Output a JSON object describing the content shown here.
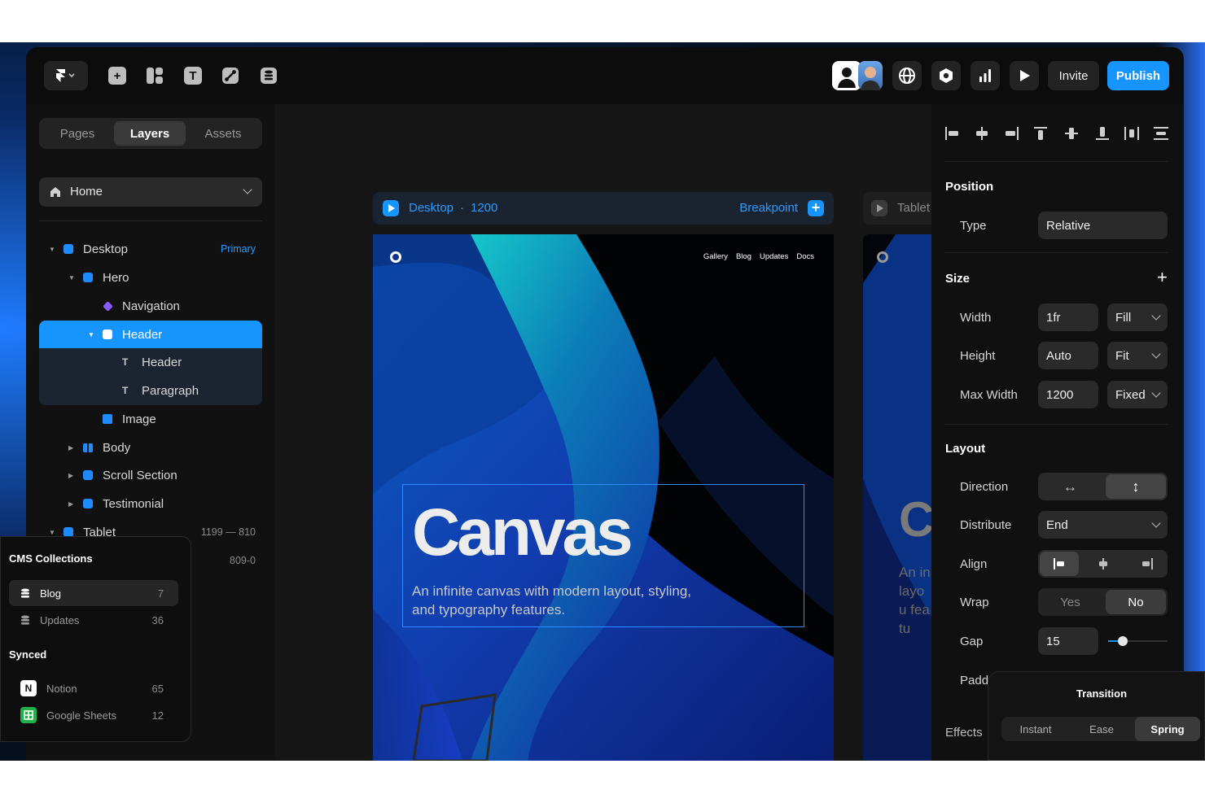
{
  "toolbar": {
    "logo_icon": "framer-logo-icon",
    "tools": [
      "insert-icon",
      "layout-icon",
      "text-icon",
      "vector-icon",
      "cms-icon"
    ],
    "right_icons": [
      "globe-icon",
      "settings-icon",
      "analytics-icon",
      "play-icon"
    ],
    "invite_label": "Invite",
    "publish_label": "Publish",
    "accent": "#1795ff"
  },
  "left_panel": {
    "tabs": [
      "Pages",
      "Layers",
      "Assets"
    ],
    "active_tab": "Layers",
    "page_select": "Home",
    "layers": [
      {
        "label": "Desktop",
        "tag": "Primary"
      },
      {
        "label": "Hero"
      },
      {
        "label": "Navigation"
      },
      {
        "label": "Header"
      },
      {
        "label": "Header"
      },
      {
        "label": "Paragraph"
      },
      {
        "label": "Image"
      },
      {
        "label": "Body"
      },
      {
        "label": "Scroll Section"
      },
      {
        "label": "Testimonial"
      },
      {
        "label": "Tablet",
        "range": "1199 — 810"
      },
      {
        "label": "",
        "range": "809-0"
      }
    ]
  },
  "cms": {
    "title": "CMS Collections",
    "collections": [
      {
        "name": "Blog",
        "count": "7"
      },
      {
        "name": "Updates",
        "count": "36"
      }
    ],
    "synced_title": "Synced",
    "synced": [
      {
        "name": "Notion",
        "count": "65"
      },
      {
        "name": "Google Sheets",
        "count": "12"
      }
    ]
  },
  "canvas": {
    "breakpoint_name": "Desktop",
    "breakpoint_sep": "·",
    "breakpoint_width": "1200",
    "breakpoint_label": "Breakpoint",
    "second_breakpoint": "Tablet",
    "nav_links": [
      "Gallery",
      "Blog",
      "Updates",
      "Docs"
    ],
    "hero_title": "Canvas",
    "hero_subtitle": "An infinite canvas with modern layout, styling, and typography features.",
    "second_frame_title": "C",
    "second_frame_text": "An in layou featu"
  },
  "right_panel": {
    "position_title": "Position",
    "type_label": "Type",
    "type_value": "Relative",
    "size_title": "Size",
    "width_label": "Width",
    "width_value": "1fr",
    "width_mode": "Fill",
    "height_label": "Height",
    "height_value": "Auto",
    "height_mode": "Fit",
    "maxwidth_label": "Max Width",
    "maxwidth_value": "1200",
    "maxwidth_mode": "Fixed",
    "layout_title": "Layout",
    "direction_label": "Direction",
    "distribute_label": "Distribute",
    "distribute_value": "End",
    "align_label": "Align",
    "wrap_label": "Wrap",
    "wrap_yes": "Yes",
    "wrap_no": "No",
    "gap_label": "Gap",
    "gap_value": "15",
    "padding_label": "Padd",
    "effects_label": "Effects"
  },
  "transition": {
    "title": "Transition",
    "options": [
      "Instant",
      "Ease",
      "Spring"
    ],
    "active": "Spring"
  }
}
